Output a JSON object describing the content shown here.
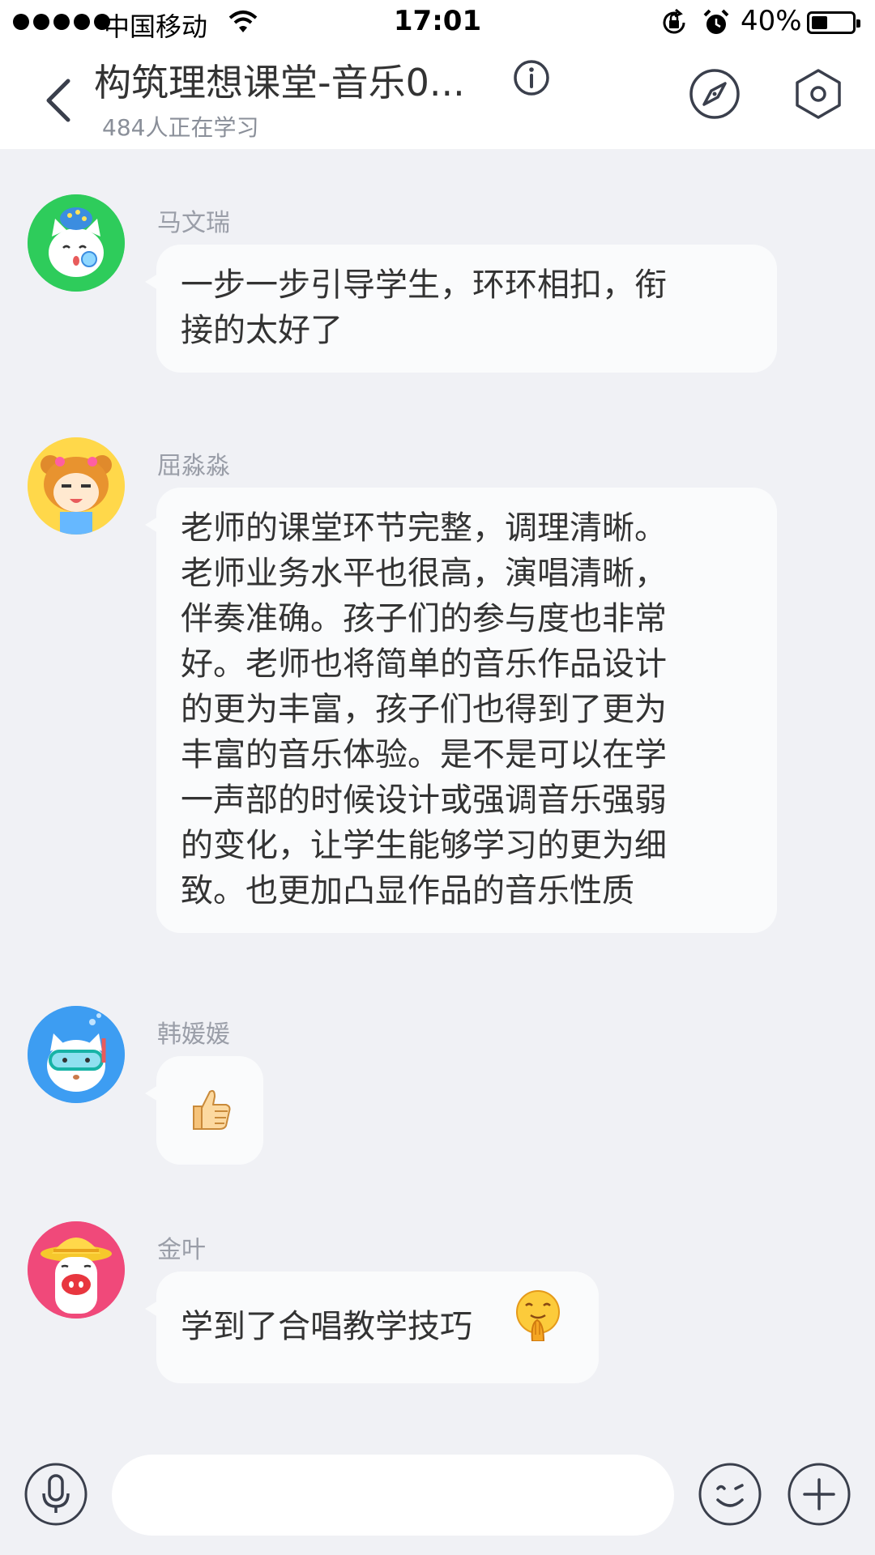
{
  "status_bar": {
    "carrier": "中国移动",
    "time": "17:01",
    "battery_percent": "40%",
    "battery_level": 0.4,
    "icons": [
      "signal-dots-icon",
      "wifi-icon",
      "rotation-lock-icon",
      "alarm-icon",
      "battery-icon"
    ]
  },
  "header": {
    "title": "构筑理想课堂-音乐0...",
    "subtitle": "484人正在学习",
    "icons": [
      "back-chevron-icon",
      "info-icon",
      "compass-icon",
      "hexagon-settings-icon"
    ]
  },
  "messages": [
    {
      "sender": "马文瑞",
      "lines": [
        "一步一步引导学生，环环相扣，衔",
        "接的太好了"
      ],
      "avatar_bg": "#2ecc5b",
      "avatar_icon": "cat-whistle-avatar-icon"
    },
    {
      "sender": "屈淼淼",
      "lines": [
        "老师的课堂环节完整，调理清晰。",
        "老师业务水平也很高，演唱清晰，",
        "伴奏准确。孩子们的参与度也非常",
        "好。老师也将简单的音乐作品设计",
        "的更为丰富，孩子们也得到了更为",
        "丰富的音乐体验。是不是可以在学",
        "一声部的时候设计或强调音乐强弱",
        "的变化，让学生能够学习的更为细",
        "致。也更加凸显作品的音乐性质"
      ],
      "avatar_bg": "#ffd84a",
      "avatar_icon": "tiger-costume-avatar-icon"
    },
    {
      "sender": "韩媛媛",
      "emoji": "thumbs-up-icon",
      "avatar_bg": "#3d9df2",
      "avatar_icon": "cat-snorkel-avatar-icon"
    },
    {
      "sender": "金叶",
      "lines": [
        "学到了合唱教学技巧"
      ],
      "trailing_emoji": "shushing-face-icon",
      "avatar_bg": "#f0497a",
      "avatar_icon": "pig-sunhat-avatar-icon"
    }
  ],
  "input_bar": {
    "placeholder": "",
    "icons": [
      "microphone-icon",
      "smiley-icon",
      "plus-icon"
    ]
  },
  "colors": {
    "chat_background": "#f0f1f5",
    "bubble": "#fafbfc",
    "header_background": "#ffffff",
    "muted_text": "#9a9ea8",
    "icon_stroke": "#3a3f4c"
  }
}
